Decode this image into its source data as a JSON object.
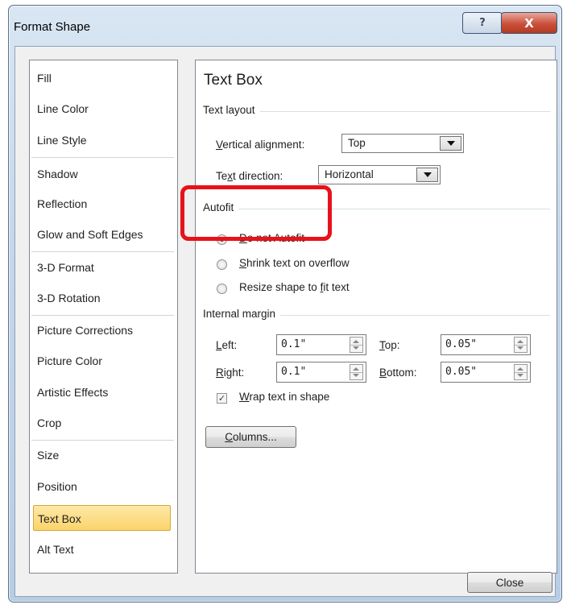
{
  "window": {
    "title": "Format Shape",
    "help_glyph": "?",
    "close_glyph": "X"
  },
  "sidebar": {
    "items": [
      {
        "label": "Fill"
      },
      {
        "label": "Line Color"
      },
      {
        "label": "Line Style"
      },
      {
        "label": "Shadow"
      },
      {
        "label": "Reflection"
      },
      {
        "label": "Glow and Soft Edges"
      },
      {
        "label": "3-D Format"
      },
      {
        "label": "3-D Rotation"
      },
      {
        "label": "Picture Corrections"
      },
      {
        "label": "Picture Color"
      },
      {
        "label": "Artistic Effects"
      },
      {
        "label": "Crop"
      },
      {
        "label": "Size"
      },
      {
        "label": "Position"
      },
      {
        "label": "Text Box"
      },
      {
        "label": "Alt Text"
      }
    ],
    "selected": "Text Box"
  },
  "panel": {
    "title": "Text Box",
    "text_layout": {
      "heading": "Text layout",
      "vertical_alignment": {
        "label_a": "V",
        "label_b": "ertical alignment:",
        "value": "Top"
      },
      "text_direction": {
        "label_a": "Te",
        "label_b": "x",
        "label_c": "t direction:",
        "value": "Horizontal"
      }
    },
    "autofit": {
      "heading": "Autofit",
      "options": [
        {
          "u": "D",
          "rest": "o not Autofit",
          "checked": true
        },
        {
          "u": "S",
          "rest": "hrink text on overflow",
          "checked": false
        },
        {
          "pre": "Resize shape to ",
          "u": "f",
          "rest": "it text",
          "checked": false
        }
      ]
    },
    "internal_margin": {
      "heading": "Internal margin",
      "left": {
        "u": "L",
        "rest": "eft:",
        "value": "0.1\""
      },
      "right": {
        "u": "R",
        "rest": "ight:",
        "value": "0.1\""
      },
      "top": {
        "u": "T",
        "rest": "op:",
        "value": "0.05\""
      },
      "bottom": {
        "u": "B",
        "rest": "ottom:",
        "value": "0.05\""
      },
      "wrap": {
        "u": "W",
        "rest": "rap text in shape",
        "checked": true,
        "glyph": "✓"
      }
    },
    "columns_button": {
      "u": "C",
      "rest": "olumns..."
    }
  },
  "footer": {
    "close_label": "Close"
  },
  "colors": {
    "highlight": "#e8121a",
    "selected_item": "#fbd36a"
  }
}
